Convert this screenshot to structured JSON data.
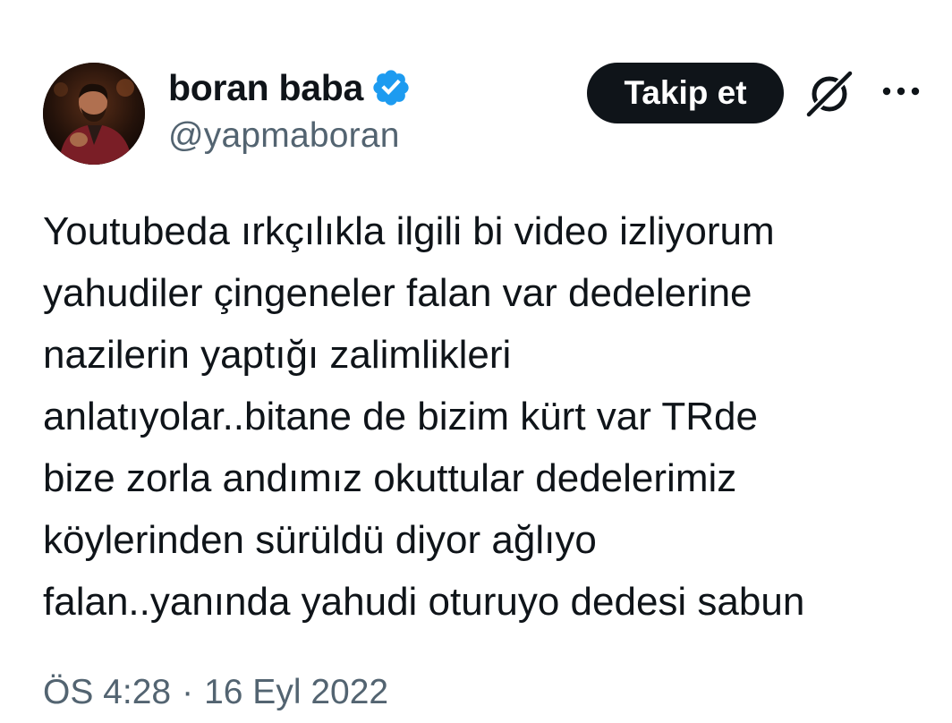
{
  "author": {
    "display_name": "boran baba",
    "handle": "@yapmaboran",
    "verified": true
  },
  "actions": {
    "follow_label": "Takip et",
    "grok_icon": "grok-icon",
    "more_icon": "more-options-icon"
  },
  "tweet": {
    "lines": [
      "Youtubeda ırkçılıkla ilgili bi video izliyorum",
      "yahudiler çingeneler falan var dedelerine",
      "nazilerin yaptığı zalimlikleri",
      "anlatıyolar..bitane de bizim kürt var TRde",
      "bize zorla andımız okuttular dedelerimiz",
      "köylerinden sürüldü diyor ağlıyo",
      "falan..yanında yahudi oturuyo dedesi sabun"
    ]
  },
  "meta": {
    "time": "ÖS 4:28",
    "separator": "·",
    "date": "16 Eyl 2022"
  },
  "colors": {
    "text_primary": "#0f1419",
    "text_secondary": "#536471",
    "verified_blue": "#1d9bf0",
    "button_bg": "#0f1419"
  }
}
